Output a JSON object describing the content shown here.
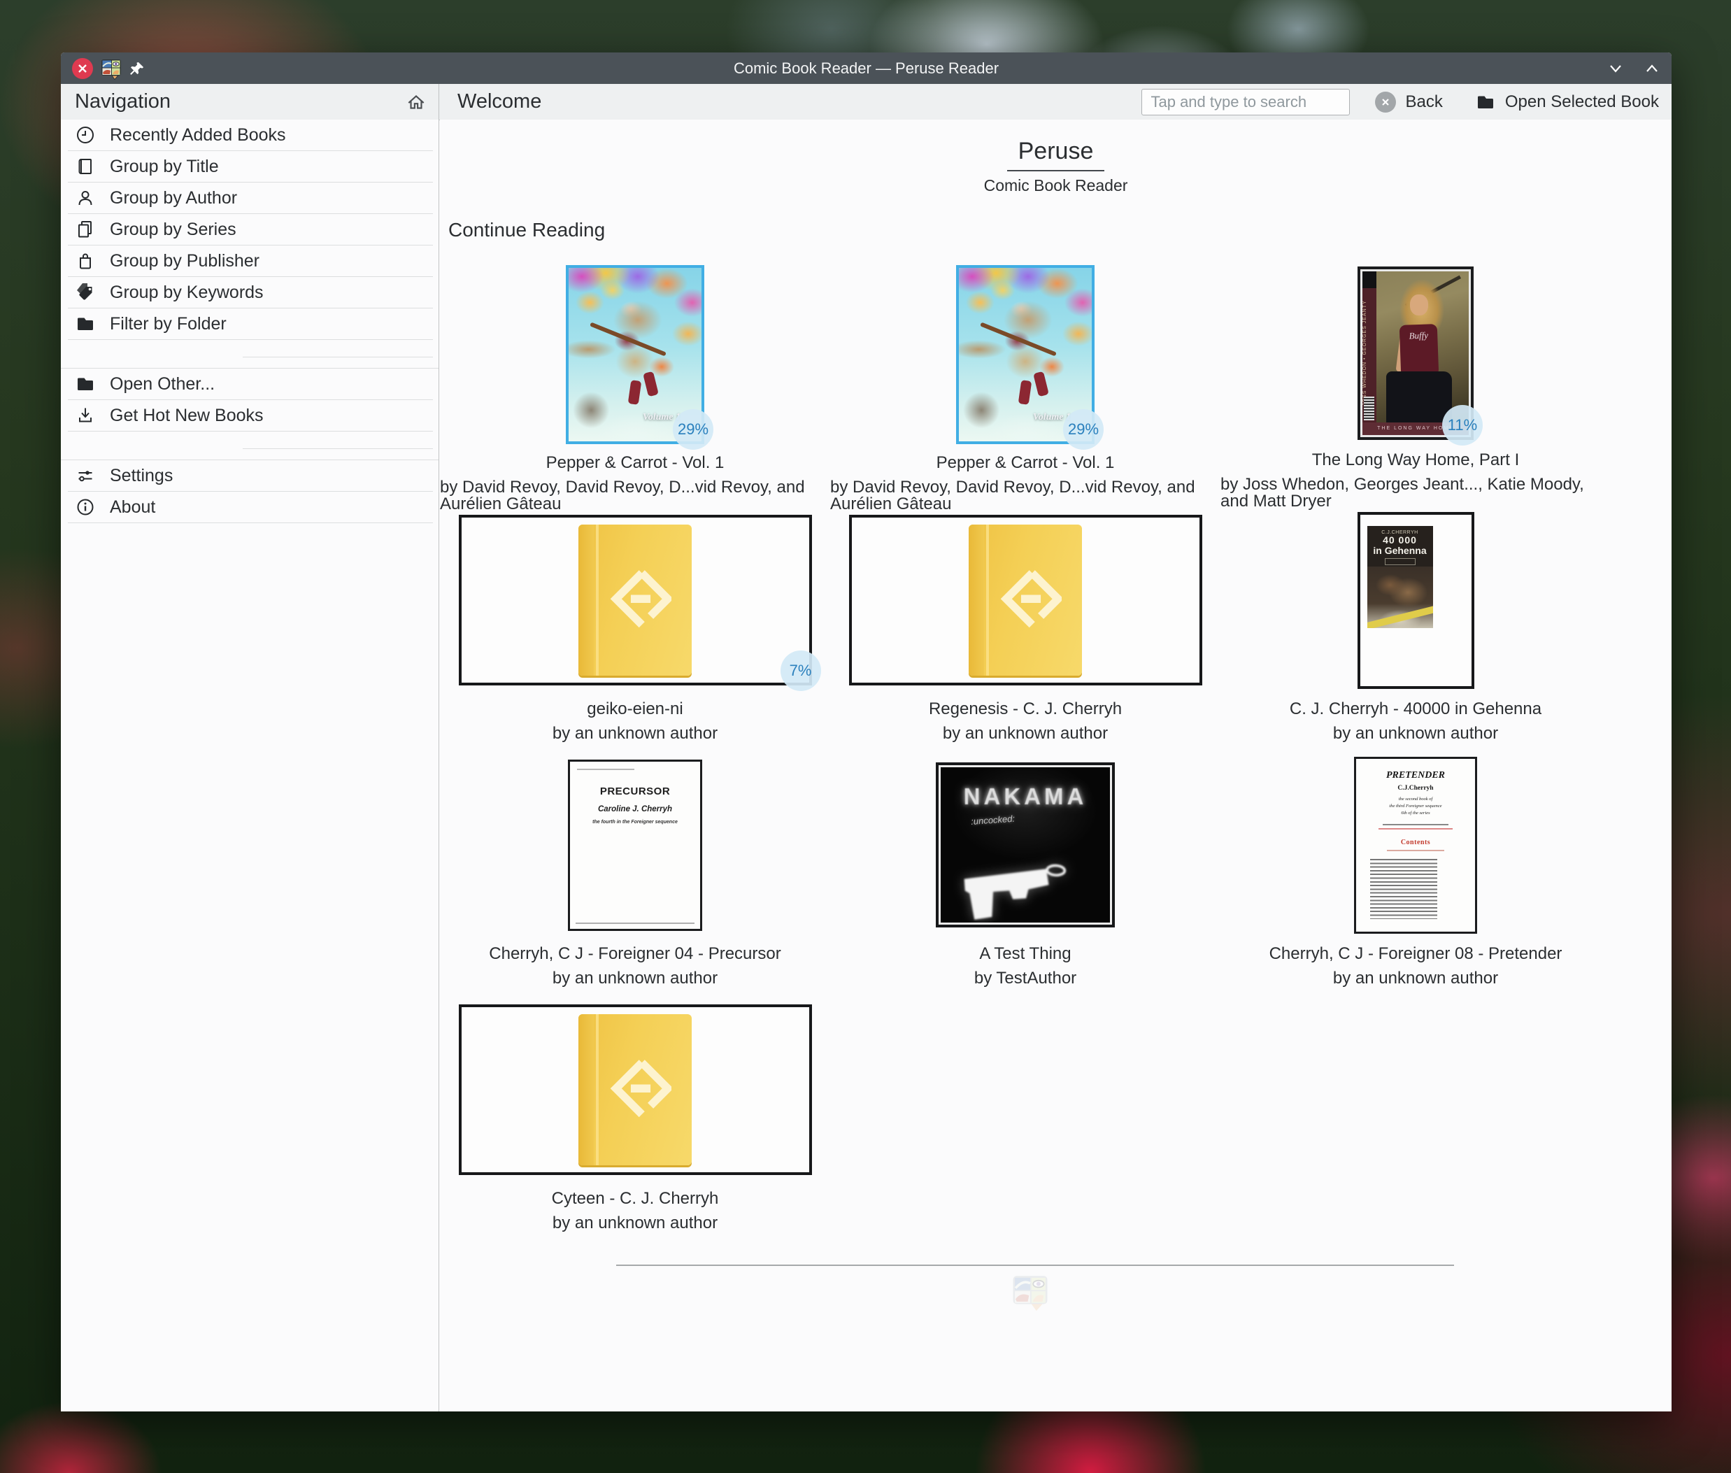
{
  "window": {
    "title": "Comic Book Reader — Peruse Reader"
  },
  "icons": {
    "close_icon": "x-in-red-circle",
    "app_icon": "peruse-colorful-speech-bubble",
    "pin_icon": "pushpin",
    "chevron_down_icon": "v",
    "chevron_up_icon": "^",
    "home_icon": "house-outline",
    "back_icon": "x-in-gray-circle",
    "open_book_icon": "folder"
  },
  "sidebar": {
    "title": "Navigation",
    "items": [
      {
        "label": "Recently Added Books",
        "icon": "clock-icon"
      },
      {
        "label": "Group by Title",
        "icon": "book-icon"
      },
      {
        "label": "Group by Author",
        "icon": "person-icon"
      },
      {
        "label": "Group by Series",
        "icon": "pages-icon"
      },
      {
        "label": "Group by Publisher",
        "icon": "bag-icon"
      },
      {
        "label": "Group by Keywords",
        "icon": "tags-icon"
      },
      {
        "label": "Filter by Folder",
        "icon": "folder-icon"
      },
      {
        "label": "Open Other...",
        "icon": "folder-icon"
      },
      {
        "label": "Get Hot New Books",
        "icon": "download-icon"
      },
      {
        "label": "Settings",
        "icon": "sliders-icon"
      },
      {
        "label": "About",
        "icon": "info-icon"
      }
    ]
  },
  "header": {
    "welcome_title": "Welcome",
    "search_placeholder": "Tap and type to search",
    "back_label": "Back",
    "open_selected_label": "Open Selected Book"
  },
  "main": {
    "app_name": "Peruse",
    "app_subtitle": "Comic Book Reader",
    "section_title": "Continue Reading",
    "books": [
      {
        "title": "Pepper & Carrot - Vol. 1",
        "author": "by David Revoy, David Revoy, D...vid Revoy, and Aurélien Gâteau",
        "progress": "29%",
        "cover": "pepper",
        "cover_text": {
          "volume": "Volume 1"
        }
      },
      {
        "title": "Pepper & Carrot - Vol. 1",
        "author": "by David Revoy, David Revoy, D...vid Revoy, and Aurélien Gâteau",
        "progress": "29%",
        "cover": "pepper",
        "cover_text": {
          "volume": "Volume 1"
        }
      },
      {
        "title": "The Long Way Home, Part I",
        "author": "by Joss Whedon, Georges Jeant..., Katie Moody, and Matt Dryer",
        "progress": "11%",
        "cover": "buffy",
        "cover_text": {
          "spine": "JOSS WHEDON • GEORGES JEANTY",
          "shirt": "Buffy",
          "strip": "THE LONG WAY HOME"
        }
      },
      {
        "title": "geiko-eien-ni",
        "author": "by an unknown author",
        "progress": "7%",
        "cover": "ebook-wide"
      },
      {
        "title": "Regenesis - C. J. Cherryh",
        "author": "by an unknown author",
        "progress": null,
        "cover": "ebook-wide"
      },
      {
        "title": "C. J. Cherryh - 40000 in Gehenna",
        "author": "by an unknown author",
        "progress": null,
        "cover": "gehenna",
        "cover_text": {
          "author": "C.J.CHERRYH",
          "title1": "40 000",
          "title2": "in Gehenna"
        }
      },
      {
        "title": "Cherryh, C J - Foreigner 04 - Precursor",
        "author": "by an unknown author",
        "progress": null,
        "cover": "precursor",
        "cover_text": {
          "title": "PRECURSOR",
          "author": "Caroline J. Cherryh",
          "subtitle": "the fourth in the Foreigner sequence"
        }
      },
      {
        "title": "A Test Thing",
        "author": "by TestAuthor",
        "progress": null,
        "cover": "nakama",
        "cover_text": {
          "title": "NAKAMA",
          "subtitle": ":uncocked:"
        }
      },
      {
        "title": "Cherryh, C J - Foreigner 08 - Pretender",
        "author": "by an unknown author",
        "progress": null,
        "cover": "pretender",
        "cover_text": {
          "title": "PRETENDER",
          "author": "C.J.Cherryh",
          "line1": "the second book of",
          "line2": "the third Foreigner sequence",
          "line3": "6th of the series",
          "contents_label": "Contents"
        }
      },
      {
        "title": "Cyteen - C. J. Cherryh",
        "author": "by an unknown author",
        "progress": null,
        "cover": "ebook-wide"
      }
    ]
  }
}
